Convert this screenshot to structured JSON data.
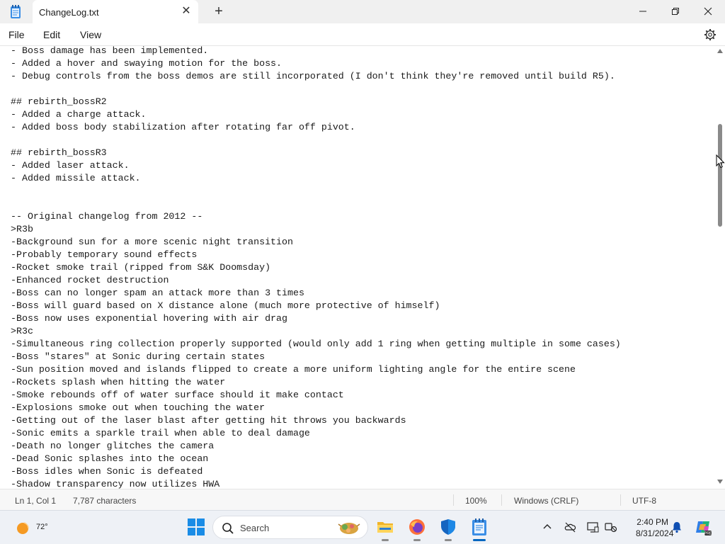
{
  "window": {
    "tab_title": "ChangeLog.txt",
    "close_tab_glyph": "✕",
    "new_tab_glyph": "+"
  },
  "menu": {
    "file": "File",
    "edit": "Edit",
    "view": "View"
  },
  "editor": {
    "lines": [
      "- Boss damage has been implemented.",
      "- Added a hover and swaying motion for the boss.",
      "- Debug controls from the boss demos are still incorporated (I don't think they're removed until build R5).",
      "",
      "## rebirth_bossR2",
      "- Added a charge attack.",
      "- Added boss body stabilization after rotating far off pivot.",
      "",
      "## rebirth_bossR3",
      "- Added laser attack.",
      "- Added missile attack.",
      "",
      "",
      "-- Original changelog from 2012 --",
      ">R3b",
      "-Background sun for a more scenic night transition",
      "-Probably temporary sound effects",
      "-Rocket smoke trail (ripped from S&K Doomsday)",
      "-Enhanced rocket destruction",
      "-Boss can no longer spam an attack more than 3 times",
      "-Boss will guard based on X distance alone (much more protective of himself)",
      "-Boss now uses exponential hovering with air drag",
      ">R3c",
      "-Simultaneous ring collection properly supported (would only add 1 ring when getting multiple in some cases)",
      "-Boss \"stares\" at Sonic during certain states",
      "-Sun position moved and islands flipped to create a more uniform lighting angle for the entire scene",
      "-Rockets splash when hitting the water",
      "-Smoke rebounds off of water surface should it make contact",
      "-Explosions smoke out when touching the water",
      "-Getting out of the laser blast after getting hit throws you backwards",
      "-Sonic emits a sparkle trail when able to deal damage",
      "-Death no longer glitches the camera",
      "-Dead Sonic splashes into the ocean",
      "-Boss idles when Sonic is defeated",
      "-Shadow transparency now utilizes HWA"
    ]
  },
  "status": {
    "position": "Ln 1, Col 1",
    "characters": "7,787 characters",
    "zoom": "100%",
    "line_ending": "Windows (CRLF)",
    "encoding": "UTF-8"
  },
  "taskbar": {
    "temperature": "72°",
    "search_label": "Search",
    "time": "2:40 PM",
    "date": "8/31/2024",
    "pinned": [
      "file-explorer-icon",
      "firefox-icon",
      "windows-security-icon",
      "notepad-icon"
    ]
  },
  "colors": {
    "accent": "#0067c0",
    "text": "#1a1a1a",
    "titlebar": "#f0f0f0"
  }
}
